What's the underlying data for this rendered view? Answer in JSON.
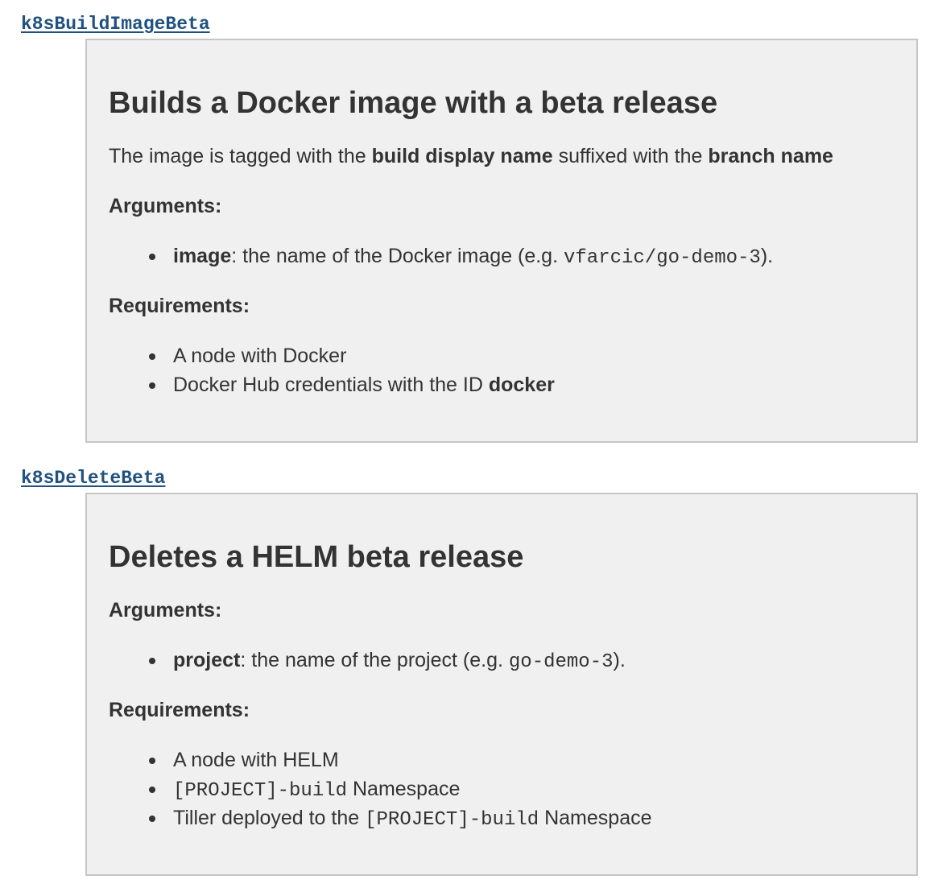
{
  "steps": [
    {
      "name": "k8sBuildImageBeta",
      "title": "Builds a Docker image with a beta release",
      "description": {
        "t1": "The image is tagged with the ",
        "b1": "build display name",
        "t2": " suffixed with the ",
        "b2": "branch name"
      },
      "arguments_heading": "Arguments:",
      "arguments": [
        {
          "name": "image",
          "text": ": the name of the Docker image (e.g. ",
          "example": "vfarcic/go-demo-3",
          "suffix": ")."
        }
      ],
      "requirements_heading": "Requirements:",
      "requirements": [
        {
          "text": "A node with Docker"
        },
        {
          "text": "Docker Hub credentials with the ID ",
          "bold": "docker"
        }
      ]
    },
    {
      "name": "k8sDeleteBeta",
      "title": "Deletes a HELM beta release",
      "arguments_heading": "Arguments:",
      "arguments": [
        {
          "name": "project",
          "text": ": the name of the project (e.g. ",
          "example": "go-demo-3",
          "suffix": ")."
        }
      ],
      "requirements_heading": "Requirements:",
      "requirements": [
        {
          "text": "A node with HELM"
        },
        {
          "code": "[PROJECT]-build",
          "text": " Namespace"
        },
        {
          "text": "Tiller deployed to the ",
          "code": "[PROJECT]-build",
          "text2": " Namespace"
        }
      ]
    }
  ]
}
